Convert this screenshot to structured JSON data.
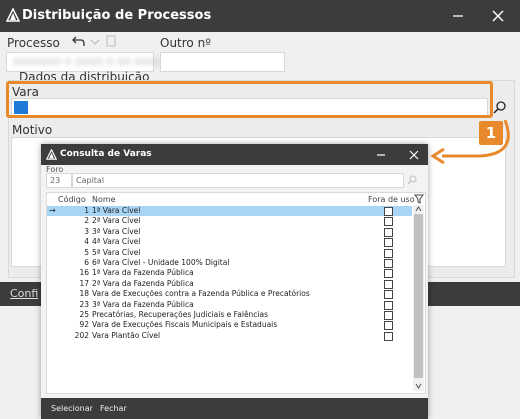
{
  "main": {
    "title": "Distribuição de Processos",
    "processo_label": "Processo",
    "processo_value": "0000000-0.0000.0.00.0000",
    "outro_label": "Outro nº",
    "dados_label": "Dados da distribuição",
    "vara_label": "Vara",
    "motivo_label": "Motivo",
    "footer_link": "Confi",
    "callout_number": "1"
  },
  "dialog": {
    "title": "Consulta de Varas",
    "foro_label": "Foro",
    "foro_code": "23",
    "foro_name": "Capital",
    "columns": {
      "code": "Código",
      "name": "Nome",
      "fora": "Fora de uso"
    },
    "rows": [
      {
        "code": "1",
        "name": "1ª Vara Cível"
      },
      {
        "code": "2",
        "name": "2ª Vara Cível"
      },
      {
        "code": "3",
        "name": "3ª Vara Cível"
      },
      {
        "code": "4",
        "name": "4ª Vara Cível"
      },
      {
        "code": "5",
        "name": "5ª Vara Cível"
      },
      {
        "code": "6",
        "name": "6ª Vara Cível - Unidade 100% Digital"
      },
      {
        "code": "16",
        "name": "1ª Vara da Fazenda Pública"
      },
      {
        "code": "17",
        "name": "2ª Vara da Fazenda Pública"
      },
      {
        "code": "18",
        "name": "Vara de Execuções contra a Fazenda Pública e Precatórios"
      },
      {
        "code": "23",
        "name": "3ª Vara da Fazenda Pública"
      },
      {
        "code": "25",
        "name": "Precatórias, Recuperações Judiciais e Falências"
      },
      {
        "code": "92",
        "name": "Vara de Execuções Fiscais Municipais e Estaduais"
      },
      {
        "code": "202",
        "name": "Vara Plantão Cível"
      }
    ],
    "selected_row_marker": "→",
    "btn_select": "Selecionar",
    "btn_close": "Fechar"
  }
}
